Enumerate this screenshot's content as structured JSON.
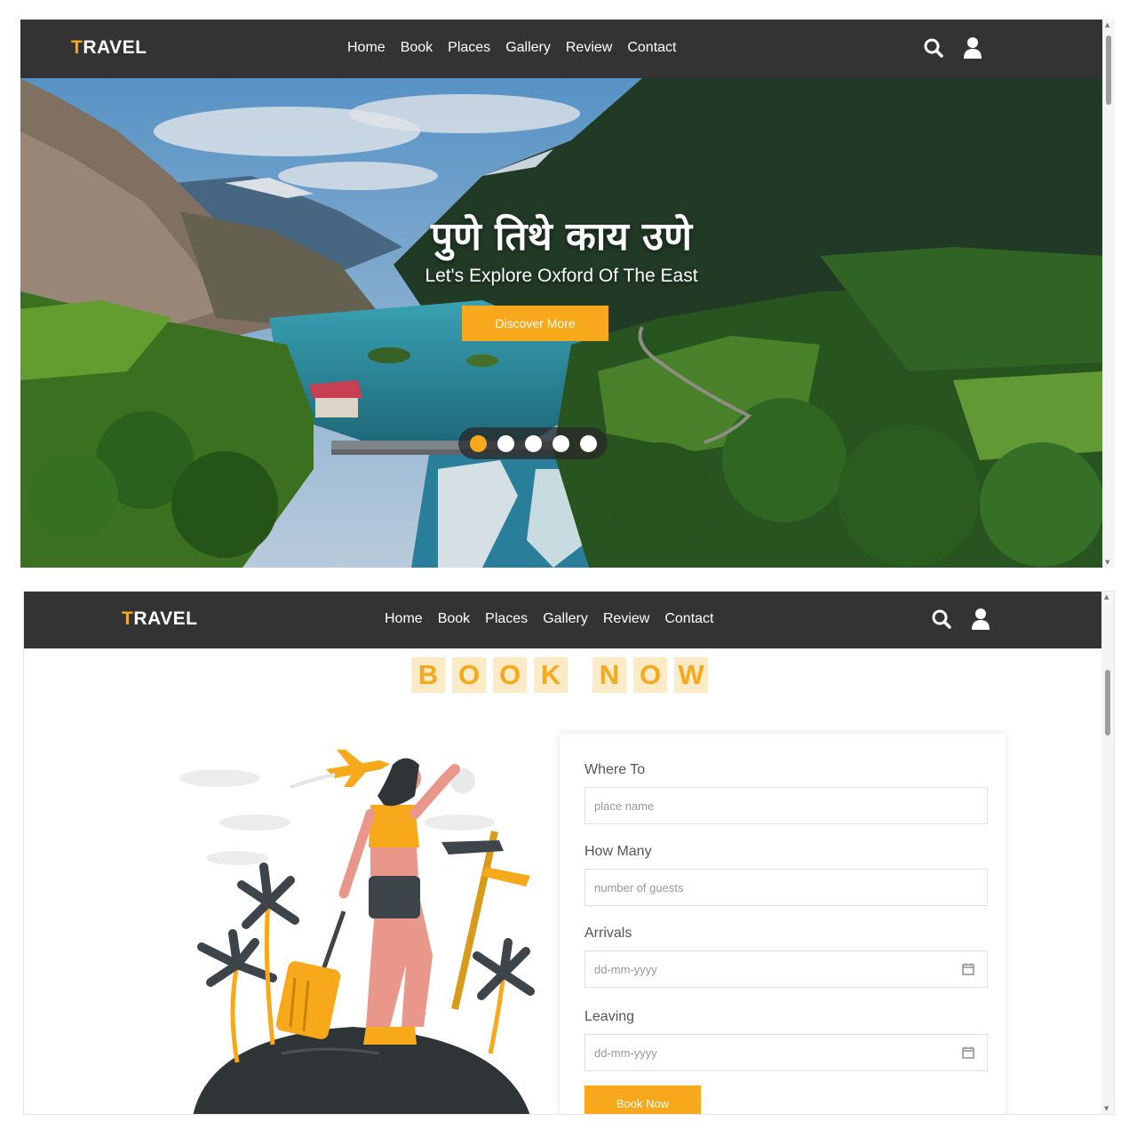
{
  "brand": {
    "first_letter": "T",
    "rest": "RAVEL",
    "accent_color": "#f7a81b",
    "nav_bg": "#333333"
  },
  "nav": {
    "items": [
      "Home",
      "Book",
      "Places",
      "Gallery",
      "Review",
      "Contact"
    ],
    "icons": [
      "search-icon",
      "user-icon"
    ]
  },
  "hero": {
    "title": "पुणे तिथे काय उणे",
    "subtitle": "Let's Explore Oxford Of The East",
    "button_label": "Discover More",
    "slides": 5,
    "active_slide": 1
  },
  "book": {
    "heading_words": [
      [
        "B",
        "O",
        "O",
        "K"
      ],
      [
        "N",
        "O",
        "W"
      ]
    ],
    "fields": [
      {
        "label": "Where To",
        "placeholder": "place name",
        "type": "text"
      },
      {
        "label": "How Many",
        "placeholder": "number of guests",
        "type": "number"
      },
      {
        "label": "Arrivals",
        "placeholder": "dd-mm-yyyy",
        "type": "date"
      },
      {
        "label": "Leaving",
        "placeholder": "dd-mm-yyyy",
        "type": "date"
      }
    ],
    "submit_label": "Book Now"
  }
}
